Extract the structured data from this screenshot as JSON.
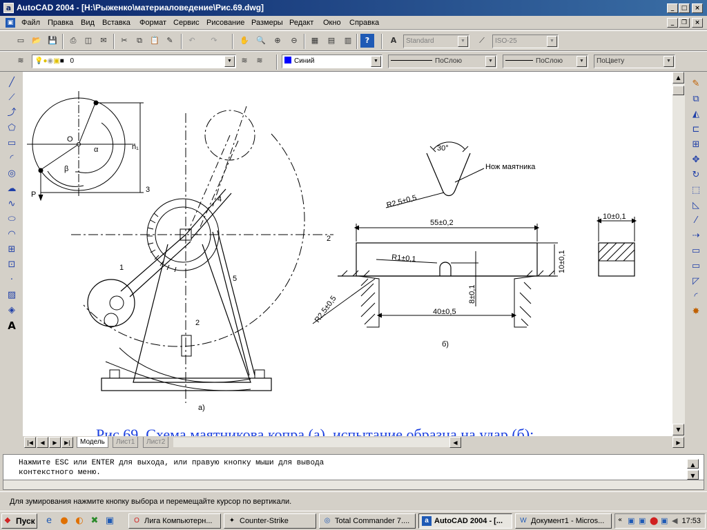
{
  "window": {
    "title": "AutoCAD 2004 - [H:\\Рыженко\\материаловедение\\Рис.69.dwg]",
    "app_icon": "a"
  },
  "menu": [
    "Файл",
    "Правка",
    "Вид",
    "Вставка",
    "Формат",
    "Сервис",
    "Рисование",
    "Размеры",
    "Редакт",
    "Окно",
    "Справка"
  ],
  "toolbar": {
    "text_style": "Standard",
    "dim_style": "ISO-25",
    "layer": "0",
    "color": "Синий",
    "linetype": "ПоСлою",
    "lineweight": "ПоСлою",
    "plotstyle": "ПоЦвету"
  },
  "drawing": {
    "label_a": "а)",
    "label_b": "б)",
    "caption": "Рис.69. Схема маятникова копра (а), испытание образца на удар (б):",
    "detail_labels": {
      "O": "O",
      "alpha": "α",
      "beta": "β",
      "h1": "h₁",
      "P": "P",
      "n1": "1",
      "n2": "2",
      "n3": "3",
      "n4": "4",
      "n5": "5",
      "spec_2": "2",
      "spec_2b": "2"
    },
    "dims": {
      "angle": "30°",
      "knife": "Нож маятника",
      "r_knife": "R2,5±0,5",
      "len": "55±0,2",
      "r1": "R1±0,1",
      "h": "10±0,1",
      "h2": "8±0,1",
      "span": "40±0,5",
      "r_support": "R2,5±0,5",
      "width": "10±0,1"
    }
  },
  "tabs": {
    "model": "Модель",
    "sheet1": "Лист1",
    "sheet2": "Лист2"
  },
  "command": {
    "line1": "Нажмите ESC или ENTER для выхода, или правую кнопку мыши для вывода",
    "line2": "контекстного меню."
  },
  "status": "Для зумирования нажмите кнопку выбора и перемещайте курсор по вертикали.",
  "taskbar": {
    "start": "Пуск",
    "tasks": [
      {
        "label": "Лига Компьютерн...",
        "icon": "opera-icon"
      },
      {
        "label": "Counter-Strike",
        "icon": "cs-icon"
      },
      {
        "label": "Total Commander 7....",
        "icon": "totalcmd-icon"
      },
      {
        "label": "AutoCAD 2004 - [...",
        "icon": "autocad-icon"
      },
      {
        "label": "Документ1 - Micros...",
        "icon": "word-icon"
      }
    ],
    "clock": "17:53"
  },
  "colors": {
    "title_bar": "#0a246a",
    "drawing_lines": "#000000",
    "caption": "#1a3fe0",
    "layer_color": "#0000ff"
  }
}
